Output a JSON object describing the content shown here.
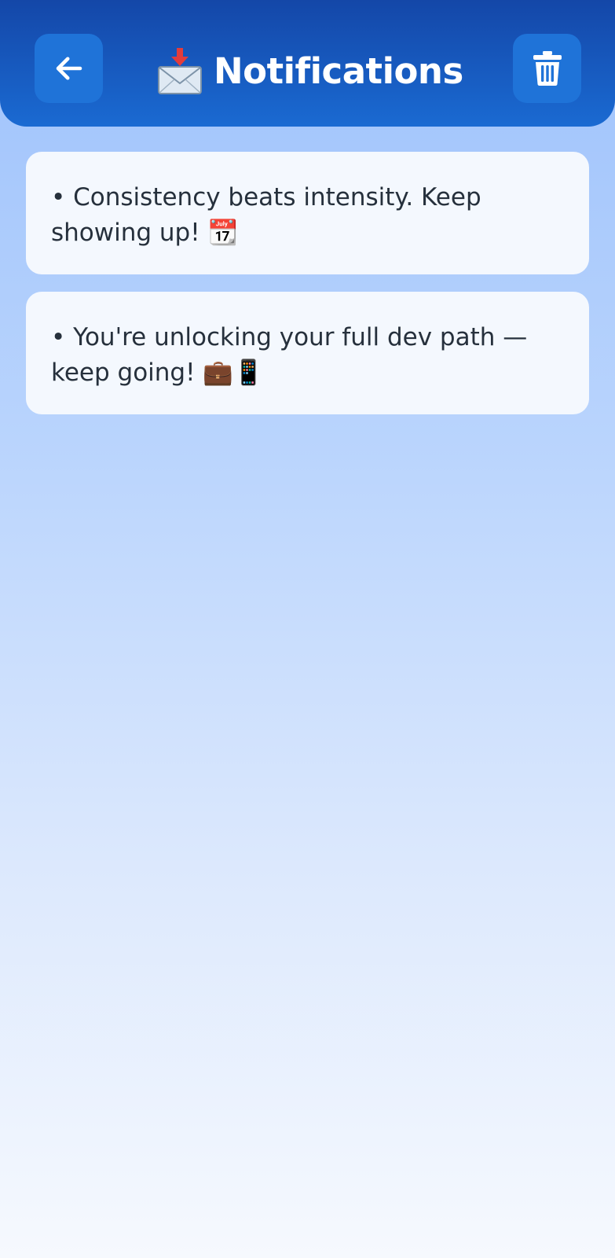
{
  "header": {
    "title": "Notifications",
    "title_icon": "incoming-envelope-icon",
    "back_icon": "arrow-left-icon",
    "delete_icon": "trash-icon"
  },
  "notifications": [
    {
      "text": "• Consistency beats intensity. Keep\nshowing up! 📆"
    },
    {
      "text": "• You're unlocking your full dev path —\nkeep going! 💼📱"
    }
  ],
  "colors": {
    "header": "#1a5cc4",
    "button": "#1f73d8",
    "card": "#f4f8fe",
    "text": "#26303c",
    "background_top": "#9ec2fb",
    "background_bottom": "#f6f9fe"
  }
}
